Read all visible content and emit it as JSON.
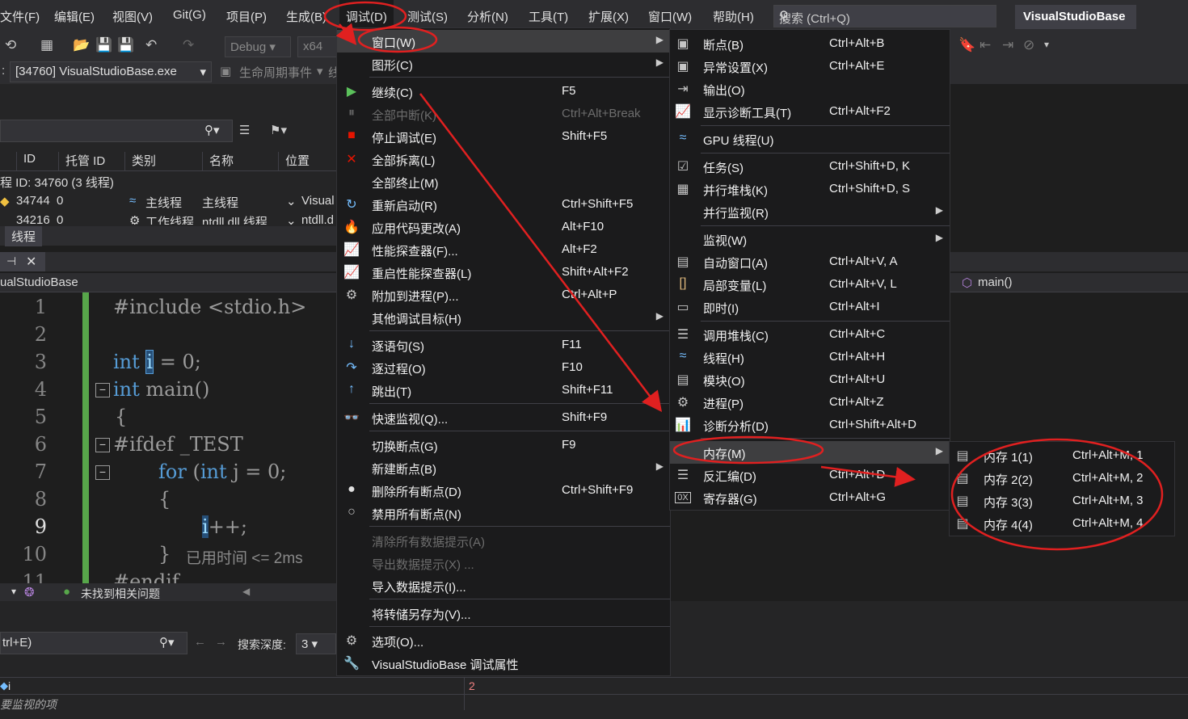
{
  "menubar": {
    "items": [
      "文件(F)",
      "编辑(E)",
      "视图(V)",
      "Git(G)",
      "项目(P)",
      "生成(B)",
      "调试(D)",
      "测试(S)",
      "分析(N)",
      "工具(T)",
      "扩展(X)",
      "窗口(W)",
      "帮助(H)"
    ],
    "search_placeholder": "搜索 (Ctrl+Q)",
    "solution_name": "VisualStudioBase"
  },
  "toolbar": {
    "config": "Debug",
    "platform": "x64",
    "process": "[34760] VisualStudioBase.exe",
    "lifecycle": "生命周期事件",
    "lifecycle_suffix": "线"
  },
  "threads_panel": {
    "columns": [
      "ID",
      "托管 ID",
      "类别",
      "名称",
      "位置"
    ],
    "group_label": "程 ID: 34760  (3 线程)",
    "rows": [
      {
        "id": "34744",
        "managed": "0",
        "category": "主线程",
        "name": "主线程",
        "location": "Visual"
      },
      {
        "id": "34216",
        "managed": "0",
        "category": "工作线程",
        "name": "ntdll.dll 线程",
        "location": "ntdll.d"
      }
    ],
    "tab_label": "线程"
  },
  "editor": {
    "file_label": "ualStudioBase",
    "function_label": "main()",
    "line_numbers": [
      "1",
      "2",
      "3",
      "4",
      "5",
      "6",
      "7",
      "8",
      "9",
      "10",
      "11"
    ],
    "lines": {
      "l1": "#include <stdio.h>",
      "l3_kw": "int",
      "l3_var": "i",
      "l3_rest": " = 0;",
      "l4_kw": "int",
      "l4_rest": " main()",
      "l5": "{",
      "l6_dir": "#ifdef",
      "l6_rest": " _TEST",
      "l7_for": "for",
      "l7_p": " (",
      "l7_int": "int",
      "l7_rest": " j = 0;",
      "l8": "{",
      "l9_var": "i",
      "l9_rest": "++;",
      "l10_brace": "}",
      "l10_time": "已用时间 <= 2ms",
      "l11": "#endif"
    },
    "status_text": "未找到相关问题"
  },
  "watch_panel": {
    "search_hint": "trl+E)",
    "search_depth_label": "搜索深度:",
    "search_depth_value": "3",
    "row_name": "i",
    "row_value": "2",
    "add_hint": "要监视的项"
  },
  "debug_menu": {
    "items": [
      {
        "label": "窗口(W)",
        "shortcut": "",
        "icon": "",
        "submenu": true
      },
      {
        "label": "图形(C)",
        "shortcut": "",
        "icon": "",
        "submenu": true
      },
      {
        "label": "继续(C)",
        "shortcut": "F5",
        "icon": "▶"
      },
      {
        "label": "全部中断(K)",
        "shortcut": "Ctrl+Alt+Break",
        "icon": "⏸"
      },
      {
        "label": "停止调试(E)",
        "shortcut": "Shift+F5",
        "icon": "■"
      },
      {
        "label": "全部拆离(L)",
        "shortcut": "",
        "icon": "✕"
      },
      {
        "label": "全部终止(M)",
        "shortcut": "",
        "icon": ""
      },
      {
        "label": "重新启动(R)",
        "shortcut": "Ctrl+Shift+F5",
        "icon": "↻"
      },
      {
        "label": "应用代码更改(A)",
        "shortcut": "Alt+F10",
        "icon": "🔥"
      },
      {
        "label": "性能探查器(F)...",
        "shortcut": "Alt+F2",
        "icon": "📈"
      },
      {
        "label": "重启性能探查器(L)",
        "shortcut": "Shift+Alt+F2",
        "icon": "📈"
      },
      {
        "label": "附加到进程(P)...",
        "shortcut": "Ctrl+Alt+P",
        "icon": "⚙"
      },
      {
        "label": "其他调试目标(H)",
        "shortcut": "",
        "icon": "",
        "submenu": true
      },
      {
        "label": "逐语句(S)",
        "shortcut": "F11",
        "icon": "↓"
      },
      {
        "label": "逐过程(O)",
        "shortcut": "F10",
        "icon": "↷"
      },
      {
        "label": "跳出(T)",
        "shortcut": "Shift+F11",
        "icon": "↑"
      },
      {
        "label": "快速监视(Q)...",
        "shortcut": "Shift+F9",
        "icon": "👓"
      },
      {
        "label": "切换断点(G)",
        "shortcut": "F9",
        "icon": ""
      },
      {
        "label": "新建断点(B)",
        "shortcut": "",
        "icon": "",
        "submenu": true
      },
      {
        "label": "删除所有断点(D)",
        "shortcut": "Ctrl+Shift+F9",
        "icon": "●"
      },
      {
        "label": "禁用所有断点(N)",
        "shortcut": "",
        "icon": "○"
      },
      {
        "label": "清除所有数据提示(A)",
        "shortcut": "",
        "icon": ""
      },
      {
        "label": "导出数据提示(X) ...",
        "shortcut": "",
        "icon": ""
      },
      {
        "label": "导入数据提示(I)...",
        "shortcut": "",
        "icon": ""
      },
      {
        "label": "将转储另存为(V)...",
        "shortcut": "",
        "icon": ""
      },
      {
        "label": "选项(O)...",
        "shortcut": "",
        "icon": "⚙"
      },
      {
        "label": "VisualStudioBase 调试属性",
        "shortcut": "",
        "icon": "🔧"
      }
    ]
  },
  "window_submenu": {
    "items": [
      {
        "label": "断点(B)",
        "shortcut": "Ctrl+Alt+B",
        "icon": "▣"
      },
      {
        "label": "异常设置(X)",
        "shortcut": "Ctrl+Alt+E",
        "icon": "▣"
      },
      {
        "label": "输出(O)",
        "shortcut": "",
        "icon": "⇥"
      },
      {
        "label": "显示诊断工具(T)",
        "shortcut": "Ctrl+Alt+F2",
        "icon": "📈"
      },
      {
        "label": "GPU 线程(U)",
        "shortcut": "",
        "icon": "≈"
      },
      {
        "label": "任务(S)",
        "shortcut": "Ctrl+Shift+D, K",
        "icon": "☑"
      },
      {
        "label": "并行堆栈(K)",
        "shortcut": "Ctrl+Shift+D, S",
        "icon": "▦"
      },
      {
        "label": "并行监视(R)",
        "shortcut": "",
        "icon": "",
        "submenu": true
      },
      {
        "label": "监视(W)",
        "shortcut": "",
        "icon": "",
        "submenu": true
      },
      {
        "label": "自动窗口(A)",
        "shortcut": "Ctrl+Alt+V, A",
        "icon": "▤"
      },
      {
        "label": "局部变量(L)",
        "shortcut": "Ctrl+Alt+V, L",
        "icon": "[]"
      },
      {
        "label": "即时(I)",
        "shortcut": "Ctrl+Alt+I",
        "icon": "▭"
      },
      {
        "label": "调用堆栈(C)",
        "shortcut": "Ctrl+Alt+C",
        "icon": "☰"
      },
      {
        "label": "线程(H)",
        "shortcut": "Ctrl+Alt+H",
        "icon": "≈"
      },
      {
        "label": "模块(O)",
        "shortcut": "Ctrl+Alt+U",
        "icon": "▤"
      },
      {
        "label": "进程(P)",
        "shortcut": "Ctrl+Alt+Z",
        "icon": "⚙"
      },
      {
        "label": "诊断分析(D)",
        "shortcut": "Ctrl+Shift+Alt+D",
        "icon": "📊"
      },
      {
        "label": "内存(M)",
        "shortcut": "",
        "icon": "",
        "submenu": true
      },
      {
        "label": "反汇编(D)",
        "shortcut": "Ctrl+Alt+D",
        "icon": "☰"
      },
      {
        "label": "寄存器(G)",
        "shortcut": "Ctrl+Alt+G",
        "icon": "0X"
      }
    ]
  },
  "memory_submenu": {
    "items": [
      {
        "label": "内存 1(1)",
        "shortcut": "Ctrl+Alt+M, 1",
        "icon": "▤"
      },
      {
        "label": "内存 2(2)",
        "shortcut": "Ctrl+Alt+M, 2",
        "icon": "▤"
      },
      {
        "label": "内存 3(3)",
        "shortcut": "Ctrl+Alt+M, 3",
        "icon": "▤"
      },
      {
        "label": "内存 4(4)",
        "shortcut": "Ctrl+Alt+M, 4",
        "icon": "▤"
      }
    ]
  },
  "annotation_color": "#e02020"
}
